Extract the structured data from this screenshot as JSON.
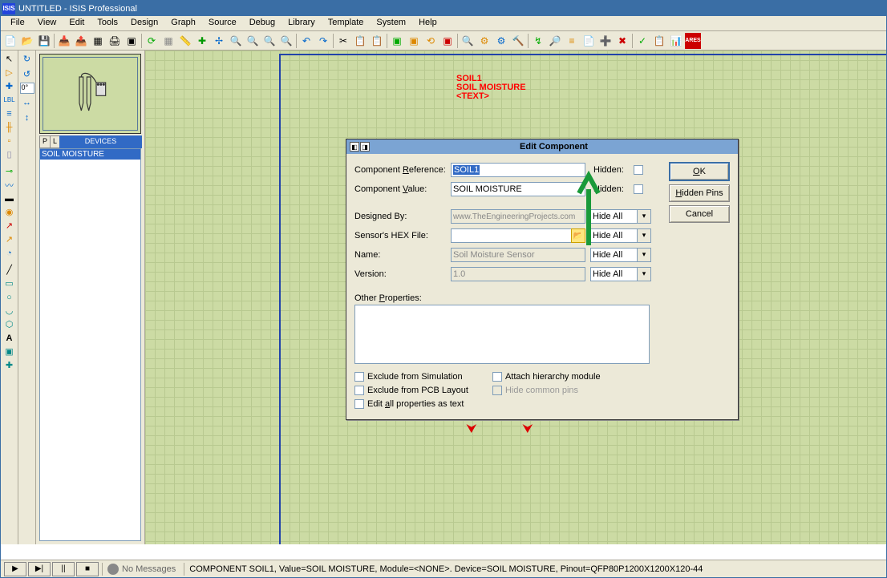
{
  "title": "UNTITLED - ISIS Professional",
  "menu": [
    "File",
    "View",
    "Edit",
    "Tools",
    "Design",
    "Graph",
    "Source",
    "Debug",
    "Library",
    "Template",
    "System",
    "Help"
  ],
  "degree": "0°",
  "devices_tab": "DEVICES",
  "tab_p": "P",
  "tab_l": "L",
  "device_list_item": "SOIL MOISTURE",
  "canvas_label": {
    "ref": "SOIL1",
    "name": "SOIL MOISTURE",
    "text": "<TEXT>"
  },
  "dialog": {
    "title": "Edit Component",
    "comp_ref_lbl": "Component Reference:",
    "comp_ref_val": "SOIL1",
    "comp_val_lbl": "Component Value:",
    "comp_val_val": "SOIL MOISTURE",
    "hidden_lbl": "Hidden:",
    "designed_by_lbl": "Designed By:",
    "designed_by_val": "www.TheEngineeringProjects.com",
    "hex_lbl": "Sensor's HEX File:",
    "hex_val": "",
    "name_lbl": "Name:",
    "name_val": "Soil Moisture Sensor",
    "version_lbl": "Version:",
    "version_val": "1.0",
    "hide_all": "Hide All",
    "other_props": "Other Properties:",
    "exclude_sim": "Exclude from Simulation",
    "exclude_pcb": "Exclude from PCB Layout",
    "edit_all": "Edit all properties as text",
    "attach_hier": "Attach hierarchy module",
    "hide_common": "Hide common pins",
    "ok_btn": "OK",
    "hidden_pins_btn": "Hidden Pins",
    "cancel_btn": "Cancel"
  },
  "status": {
    "no_msg": "No Messages",
    "comp_info": "COMPONENT SOIL1, Value=SOIL MOISTURE, Module=<NONE>. Device=SOIL MOISTURE, Pinout=QFP80P1200X1200X120-44"
  }
}
